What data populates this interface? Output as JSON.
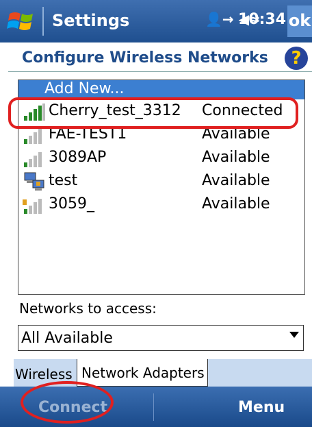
{
  "titlebar": {
    "app_title": "Settings",
    "time": "10:34",
    "ok_label": "ok",
    "status_icons": "👤→ ◀≈"
  },
  "heading": {
    "title": "Configure Wireless Networks",
    "help_glyph": "?"
  },
  "networks": {
    "add_new_label": "Add New...",
    "rows": [
      {
        "name": "Cherry_test_3312",
        "status": "Connected",
        "icon": "signal-strong-icon"
      },
      {
        "name": "FAE-TEST1",
        "status": "Available",
        "icon": "signal-weak-icon"
      },
      {
        "name": "3089AP",
        "status": "Available",
        "icon": "signal-weak-icon"
      },
      {
        "name": "test",
        "status": "Available",
        "icon": "adhoc-computer-icon"
      },
      {
        "name": "3059_",
        "status": "Available",
        "icon": "signal-weak-icon"
      }
    ]
  },
  "access": {
    "label": "Networks to access:",
    "selected": "All Available"
  },
  "tabs": {
    "wireless": "Wireless",
    "adapters": "Network Adapters"
  },
  "softkeys": {
    "left": "Connect",
    "right": "Menu"
  },
  "colors": {
    "title_bar": "#2a5a9c",
    "selection": "#3c7fd1",
    "annotation": "#e02020",
    "heading_text": "#1f4c8a"
  }
}
